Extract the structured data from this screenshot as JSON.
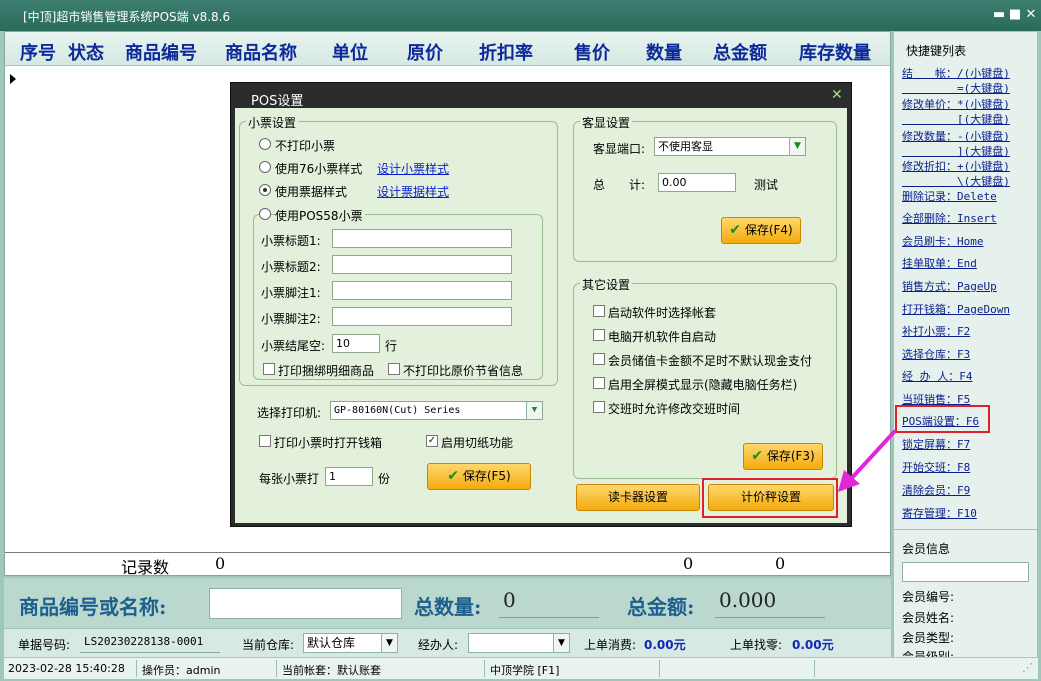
{
  "window": {
    "title": "[中顶]超市销售管理系统POS端 v8.8.6"
  },
  "grid": {
    "headers": [
      "序号",
      "状态",
      "商品编号",
      "商品名称",
      "单位",
      "原价",
      "折扣率",
      "售价",
      "数量",
      "总金额",
      "库存数量"
    ],
    "footer": {
      "label": "记录数",
      "count": "0",
      "qty": "0",
      "amount": "0"
    }
  },
  "right_panel": {
    "title": "快捷键列表",
    "shortcuts": [
      "结　　帐：/(小键盘)\n　　　　　=(大键盘)",
      "修改单价：*(小键盘)\n　　　　　[(大键盘)",
      "修改数量：-(小键盘)\n　　　　　](大键盘)",
      "修改折扣：+(小键盘)\n　　　　　\\(大键盘)",
      "删除记录：Delete",
      "全部删除：Insert",
      "会员刷卡：Home",
      "挂单取单：End",
      "销售方式：PageUp",
      "打开钱箱：PageDown",
      "补打小票：F2",
      "选择仓库：F3",
      "经 办 人：F4",
      "当班销售：F5",
      "POS端设置：F6",
      "锁定屏幕：F7",
      "开始交班：F8",
      "清除会员：F9",
      "寄存管理：F10"
    ],
    "member_title": "会员信息",
    "member_fields": [
      "会员编号:",
      "会员姓名:",
      "会员类型:",
      "会员级别:"
    ]
  },
  "input_bar": {
    "code_label": "商品编号或名称:",
    "qty_label": "总数量:",
    "qty_value": "0",
    "amount_label": "总金额:",
    "amount_value": "0.000"
  },
  "info_bar": {
    "order_label": "单据号码:",
    "order_value": "LS20230228138-0001",
    "warehouse_label": "当前仓库:",
    "warehouse_value": "默认仓库",
    "handler_label": "经办人:",
    "handler_value": "",
    "last_spend_label": "上单消费:",
    "last_spend_value": "0.00元",
    "last_change_label": "上单找零:",
    "last_change_value": "0.00元"
  },
  "status_bar": {
    "datetime": "2023-02-28 15:40:28",
    "operator": "操作员：admin",
    "account": "当前帐套：默认账套",
    "academy": "中顶学院 [F1]"
  },
  "dialog": {
    "title": "POS设置",
    "ticket": {
      "group_title": "小票设置",
      "radio_no_print": "不打印小票",
      "radio_76": "使用76小票样式",
      "link_design_ticket": "设计小票样式",
      "radio_receipt": "使用票据样式",
      "link_design_receipt": "设计票据样式",
      "radio_pos58": "使用POS58小票",
      "title1_label": "小票标题1:",
      "title2_label": "小票标题2:",
      "footer1_label": "小票脚注1:",
      "footer2_label": "小票脚注2:",
      "tail_label": "小票结尾空:",
      "tail_value": "10",
      "tail_unit": "行",
      "cb_bundle": "打印捆绑明细商品",
      "cb_no_saving": "不打印比原价节省信息",
      "printer_label": "选择打印机:",
      "printer_value": "GP-80160N(Cut) Series",
      "cb_open_drawer": "打印小票时打开钱箱",
      "cb_cut_paper": "启用切纸功能",
      "copies_label": "每张小票打",
      "copies_value": "1",
      "copies_unit": "份",
      "save_label": "保存(F5)"
    },
    "customer_display": {
      "group_title": "客显设置",
      "port_label": "客显端口:",
      "port_value": "不使用客显",
      "total_label": "总　　计:",
      "total_value": "0.00",
      "test_label": "测试",
      "save_label": "保存(F4)"
    },
    "other": {
      "group_title": "其它设置",
      "options": [
        "启动软件时选择帐套",
        "电脑开机软件自启动",
        "会员储值卡金额不足时不默认现金支付",
        "启用全屏模式显示(隐藏电脑任务栏)",
        "交班时允许修改交班时间"
      ],
      "save_label": "保存(F3)"
    },
    "card_reader_label": "读卡器设置",
    "price_scale_label": "计价秤设置"
  },
  "colors": {
    "accent_title": "#2a6a5b",
    "header_text": "#0e2a9a",
    "button": "#f3ab0d",
    "highlight": "#e0202a",
    "arrow": "#e028d8"
  }
}
